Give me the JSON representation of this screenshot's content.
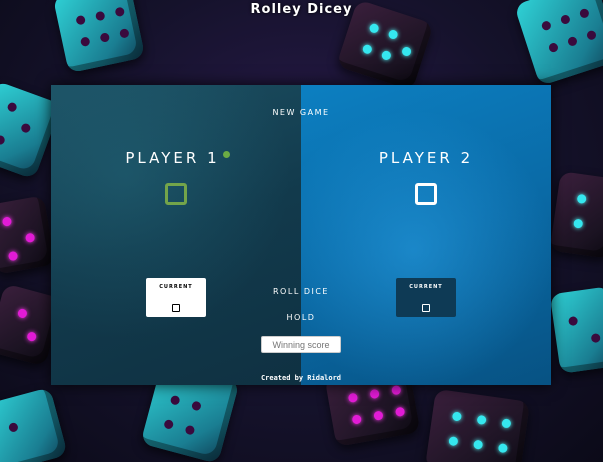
{
  "app": {
    "title": "Rolley Dicey"
  },
  "controls": {
    "new_game": "NEW GAME",
    "roll_dice": "ROLL DICE",
    "hold": "HOLD",
    "winning_score_placeholder": "Winning score"
  },
  "players": [
    {
      "name": "PLAYER 1",
      "active": true,
      "current_label": "CURRENT",
      "score": "0",
      "current": "0"
    },
    {
      "name": "PLAYER 2",
      "active": false,
      "current_label": "CURRENT",
      "score": "0",
      "current": "0"
    }
  ],
  "footer": {
    "credit": "Created by Ridalord"
  },
  "colors": {
    "active_indicator": "#6cab44",
    "panel1": "#1c5063",
    "panel2": "#0c7fc1",
    "die_pip_magenta": "#e21bd6",
    "die_pip_cyan": "#35e7ef"
  },
  "icons": {
    "background": "dice-pattern",
    "active": "active-player-dot"
  }
}
